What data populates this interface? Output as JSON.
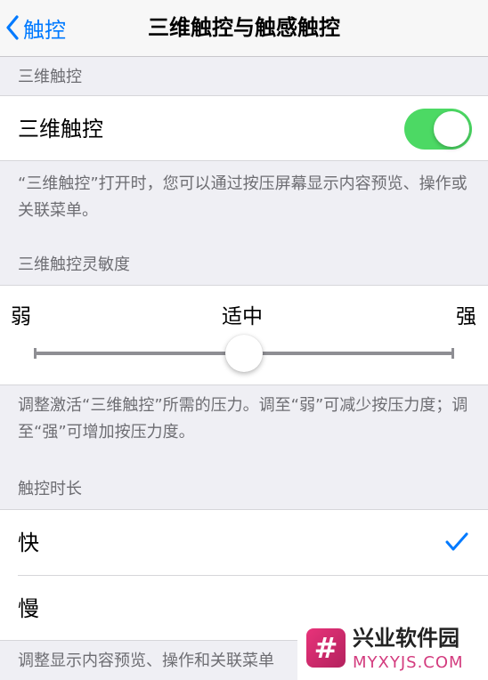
{
  "nav": {
    "back_label": "触控",
    "title": "三维触控与触感触控"
  },
  "section_3d": {
    "header": "三维触控",
    "toggle_label": "三维触控",
    "toggle_on": true,
    "footer": "“三维触控”打开时，您可以通过按压屏幕显示内容预览、操作或关联菜单。"
  },
  "section_sensitivity": {
    "header": "三维触控灵敏度",
    "min_label": "弱",
    "mid_label": "适中",
    "max_label": "强",
    "value": 0.5,
    "footer": "调整激活“三维触控”所需的压力。调至“弱”可减少按压力度；调至“强”可增加按压力度。"
  },
  "section_duration": {
    "header": "触控时长",
    "options": [
      {
        "label": "快",
        "selected": true
      },
      {
        "label": "慢",
        "selected": false
      }
    ],
    "footer": "调整显示内容预览、操作和关联菜单"
  },
  "watermark": {
    "logo_glyph": "#",
    "name": "兴业软件园",
    "url": "MYXYJS.COM"
  },
  "colors": {
    "accent": "#007aff",
    "toggle_on": "#4cd964",
    "background": "#efeff4",
    "watermark_pink": "#d33b7e"
  }
}
